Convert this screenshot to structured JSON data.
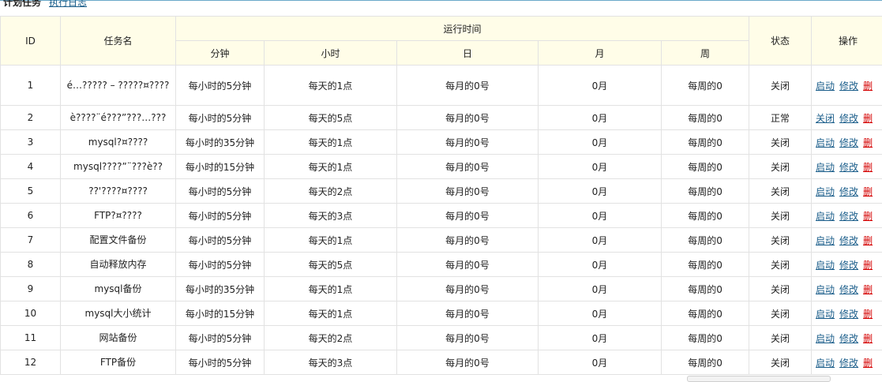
{
  "header": {
    "title": "计划任务",
    "log_link": "执行日志"
  },
  "columns": {
    "id": "ID",
    "name": "任务名",
    "run_time": "运行时间",
    "minute": "分钟",
    "hour": "小时",
    "day": "日",
    "month": "月",
    "week": "周",
    "status": "状态",
    "actions": "操作"
  },
  "rows": [
    {
      "id": "1",
      "name": "é…????? – ?????¤????",
      "minute": "每小时的5分钟",
      "hour": "每天的1点",
      "day": "每月的0号",
      "month": "0月",
      "week": "每周的0",
      "status": "关闭",
      "toggle": "启动",
      "edit": "修改",
      "del": "删"
    },
    {
      "id": "2",
      "name": "è????¨é???”???…???",
      "minute": "每小时的5分钟",
      "hour": "每天的5点",
      "day": "每月的0号",
      "month": "0月",
      "week": "每周的0",
      "status": "正常",
      "toggle": "关闭",
      "edit": "修改",
      "del": "删"
    },
    {
      "id": "3",
      "name": "mysql?¤????",
      "minute": "每小时的35分钟",
      "hour": "每天的1点",
      "day": "每月的0号",
      "month": "0月",
      "week": "每周的0",
      "status": "关闭",
      "toggle": "启动",
      "edit": "修改",
      "del": "删"
    },
    {
      "id": "4",
      "name": "mysql????”¨???è??",
      "minute": "每小时的15分钟",
      "hour": "每天的1点",
      "day": "每月的0号",
      "month": "0月",
      "week": "每周的0",
      "status": "关闭",
      "toggle": "启动",
      "edit": "修改",
      "del": "删"
    },
    {
      "id": "5",
      "name": "??'????¤????",
      "minute": "每小时的5分钟",
      "hour": "每天的2点",
      "day": "每月的0号",
      "month": "0月",
      "week": "每周的0",
      "status": "关闭",
      "toggle": "启动",
      "edit": "修改",
      "del": "删"
    },
    {
      "id": "6",
      "name": "FTP?¤????",
      "minute": "每小时的5分钟",
      "hour": "每天的3点",
      "day": "每月的0号",
      "month": "0月",
      "week": "每周的0",
      "status": "关闭",
      "toggle": "启动",
      "edit": "修改",
      "del": "删"
    },
    {
      "id": "7",
      "name": "配置文件备份",
      "minute": "每小时的5分钟",
      "hour": "每天的1点",
      "day": "每月的0号",
      "month": "0月",
      "week": "每周的0",
      "status": "关闭",
      "toggle": "启动",
      "edit": "修改",
      "del": "删"
    },
    {
      "id": "8",
      "name": "自动释放内存",
      "minute": "每小时的5分钟",
      "hour": "每天的5点",
      "day": "每月的0号",
      "month": "0月",
      "week": "每周的0",
      "status": "关闭",
      "toggle": "启动",
      "edit": "修改",
      "del": "删"
    },
    {
      "id": "9",
      "name": "mysql备份",
      "minute": "每小时的35分钟",
      "hour": "每天的1点",
      "day": "每月的0号",
      "month": "0月",
      "week": "每周的0",
      "status": "关闭",
      "toggle": "启动",
      "edit": "修改",
      "del": "删"
    },
    {
      "id": "10",
      "name": "mysql大小统计",
      "minute": "每小时的15分钟",
      "hour": "每天的1点",
      "day": "每月的0号",
      "month": "0月",
      "week": "每周的0",
      "status": "关闭",
      "toggle": "启动",
      "edit": "修改",
      "del": "删"
    },
    {
      "id": "11",
      "name": "网站备份",
      "minute": "每小时的5分钟",
      "hour": "每天的2点",
      "day": "每月的0号",
      "month": "0月",
      "week": "每周的0",
      "status": "关闭",
      "toggle": "启动",
      "edit": "修改",
      "del": "删"
    },
    {
      "id": "12",
      "name": "FTP备份",
      "minute": "每小时的5分钟",
      "hour": "每天的3点",
      "day": "每月的0号",
      "month": "0月",
      "week": "每周的0",
      "status": "关闭",
      "toggle": "启动",
      "edit": "修改",
      "del": "删"
    }
  ],
  "colors": {
    "header_bg": "#fffde8",
    "link": "#1a5d8a",
    "delete": "#d40000",
    "border": "#e2e2e2"
  }
}
